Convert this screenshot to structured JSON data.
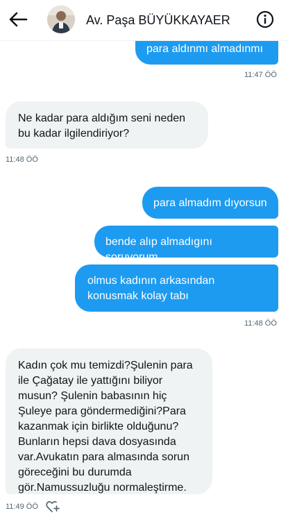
{
  "header": {
    "contact_name": "Av. Paşa BÜYÜKKAYAER",
    "back_icon": "arrow-left-icon",
    "info_icon": "info-icon"
  },
  "messages": [
    {
      "direction": "out",
      "text": "para aldınmı almadınmı"
    },
    {
      "time": "11:47 ÖÖ"
    },
    {
      "direction": "in",
      "text": "Ne kadar para aldığım seni neden bu kadar ilgilendiriyor?"
    },
    {
      "time": "11:48 ÖÖ"
    },
    {
      "direction": "out",
      "text": "para almadım dıyorsun"
    },
    {
      "direction": "out",
      "text": "bende alıp almadıgını soruyorum"
    },
    {
      "direction": "out",
      "text": "olmus kadının arkasından konusmak kolay tabı"
    },
    {
      "time": "11:48 ÖÖ"
    },
    {
      "direction": "in",
      "text": "Kadın çok mu temizdi?Şulenin para ile Çağatay ile yattığını biliyor musun? Şulenin babasının hiç Şuleye para göndermediğini?Para kazanmak için birlikte olduğunu?Bunların hepsi dava dosyasında var.Avukatın para almasında sorun göreceğini bu durumda gör.Namussuzluğu normaleştirme."
    },
    {
      "time": "11:49 ÖÖ",
      "reaction_icon": "add-reaction-icon"
    }
  ],
  "colors": {
    "outgoing_bubble": "#1d9bf0",
    "incoming_bubble": "#eff3f4",
    "timestamp": "#536471"
  }
}
